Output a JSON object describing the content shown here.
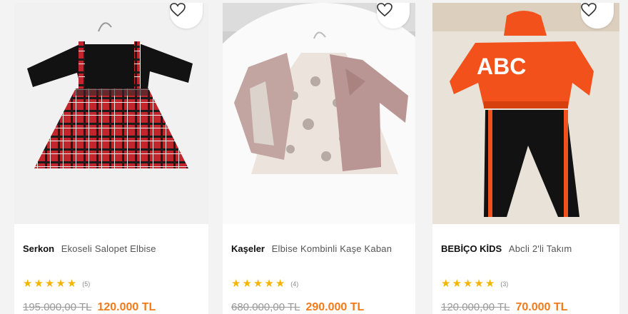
{
  "products": [
    {
      "brand": "Serkon",
      "name": "Ekoseli Salopet Elbise",
      "rating_stars": 5,
      "review_count": "(5)",
      "old_price": "195.000,00 TL",
      "new_price": "120.000 TL",
      "image_icon": "plaid-dress-image"
    },
    {
      "brand": "Kaşeler",
      "name": "Elbise Kombinli Kaşe Kaban",
      "rating_stars": 5,
      "review_count": "(4)",
      "old_price": "680.000,00 TL",
      "new_price": "290.000 TL",
      "image_icon": "dress-and-coat-image"
    },
    {
      "brand": "BEBİÇO KİDS",
      "name": "Abcli 2'li Takım",
      "rating_stars": 5,
      "review_count": "(3)",
      "old_price": "120.000,00 TL",
      "new_price": "70.000 TL",
      "image_icon": "abc-hoodie-set-image",
      "image_text": "ABC"
    }
  ],
  "colors": {
    "accent_price": "#f27a1a",
    "star": "#f5b400"
  }
}
